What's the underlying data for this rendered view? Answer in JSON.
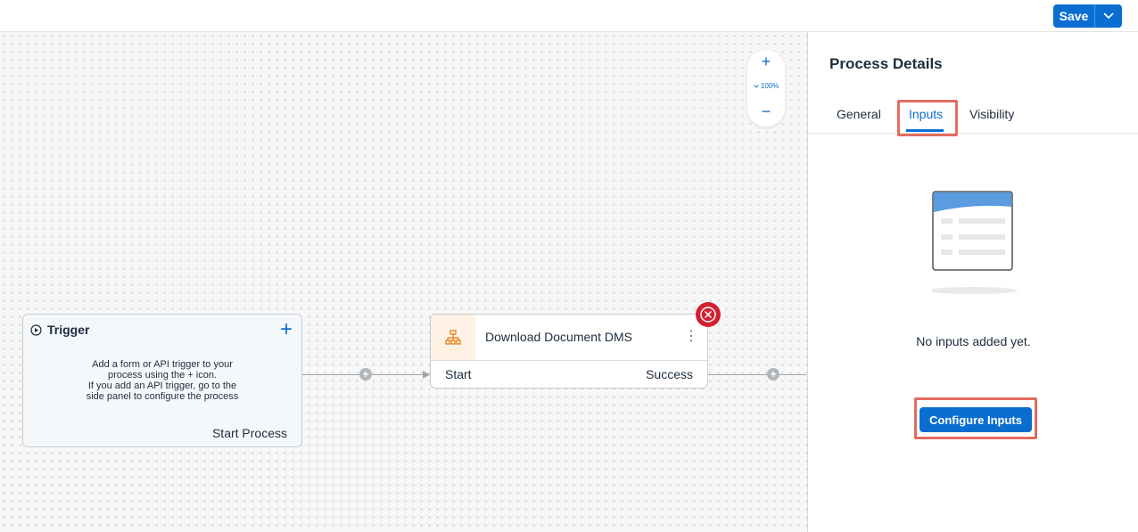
{
  "toolbar": {
    "save_label": "Save",
    "save_menu_icon": "chevron-down-icon"
  },
  "zoom": {
    "zoom_in_icon": "plus-icon",
    "level": "100%",
    "zoom_out_icon": "minus-icon"
  },
  "trigger": {
    "title": "Trigger",
    "description_lines": [
      "Add a form or API trigger to your",
      "process using the + icon.",
      "If you add an API trigger, go to the",
      "side panel to configure the process"
    ],
    "footer": "Start Process"
  },
  "task": {
    "title": "Download Document DMS",
    "start_label": "Start",
    "success_label": "Success"
  },
  "panel": {
    "title": "Process Details",
    "tabs": [
      {
        "label": "General"
      },
      {
        "label": "Inputs"
      },
      {
        "label": "Visibility"
      }
    ],
    "active_tab": "Inputs",
    "empty_text": "No inputs added yet.",
    "configure_label": "Configure Inputs"
  },
  "colors": {
    "accent": "#0a6ed1",
    "error": "#d32030",
    "highlight": "#e36c5f"
  }
}
